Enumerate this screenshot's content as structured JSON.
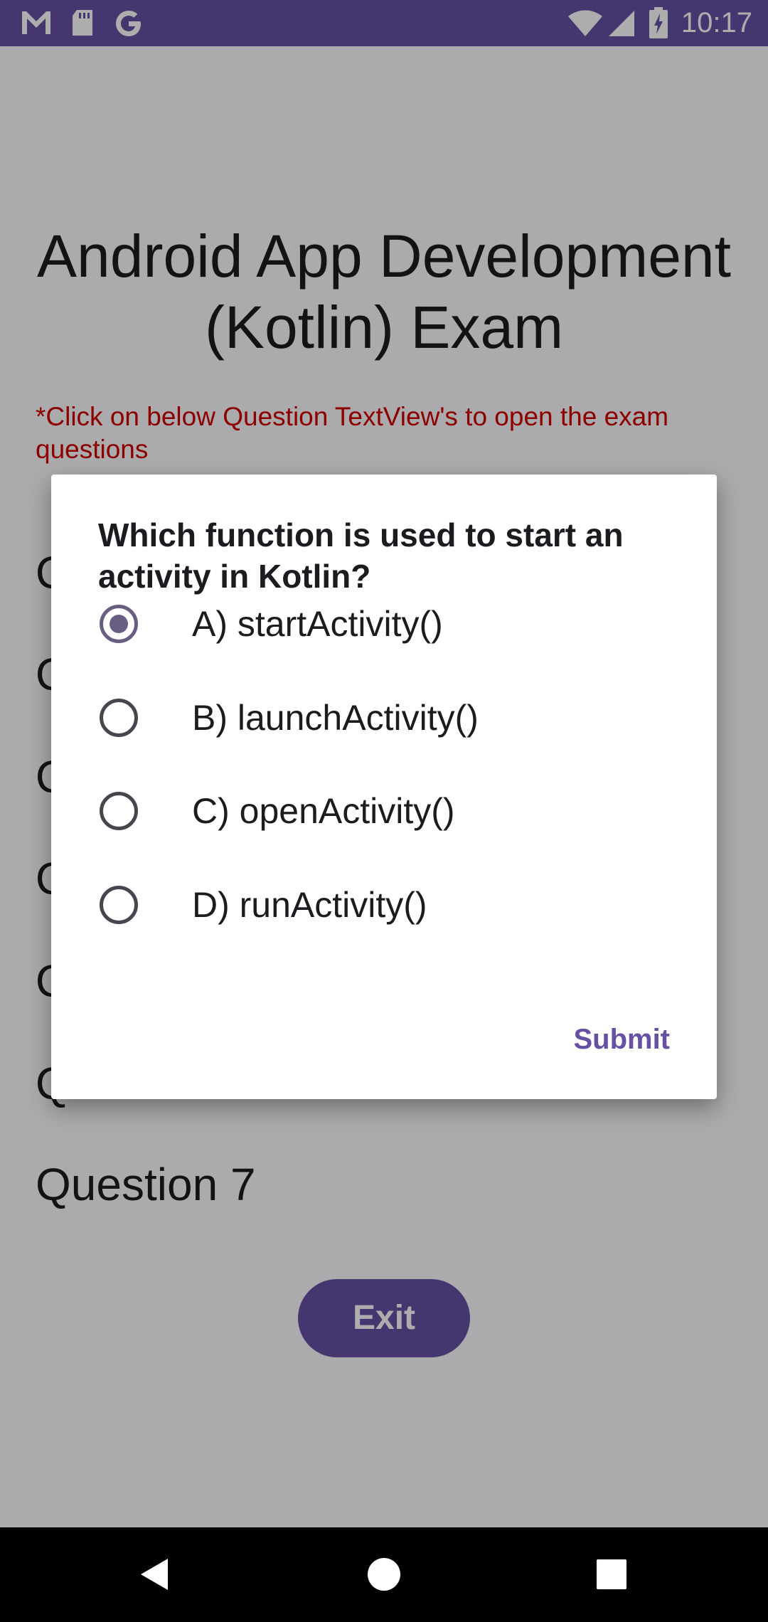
{
  "status_bar": {
    "time": "10:17",
    "icons": [
      "gmail-icon",
      "sd-card-icon",
      "google-icon",
      "wifi-icon",
      "signal-icon",
      "battery-charging-icon"
    ]
  },
  "page": {
    "title": "Android App Development (Kotlin) Exam",
    "hint": "*Click on below Question TextView's to open the exam questions",
    "questions": [
      "Q",
      "Q",
      "Q",
      "Q",
      "Q",
      "Q",
      "Question 7"
    ],
    "exit_label": "Exit"
  },
  "dialog": {
    "question": "Which function is used to start an activity in Kotlin?",
    "options": [
      {
        "label": "A) startActivity()",
        "selected": true
      },
      {
        "label": "B) launchActivity()",
        "selected": false
      },
      {
        "label": "C) openActivity()",
        "selected": false
      },
      {
        "label": "D) runActivity()",
        "selected": false
      }
    ],
    "submit_label": "Submit"
  },
  "nav_bar": {
    "icons": [
      "back-icon",
      "home-icon",
      "recents-icon"
    ]
  },
  "colors": {
    "primary": "#6750a4",
    "hint_red": "#d00000",
    "radio_checked": "#6a5d82"
  }
}
